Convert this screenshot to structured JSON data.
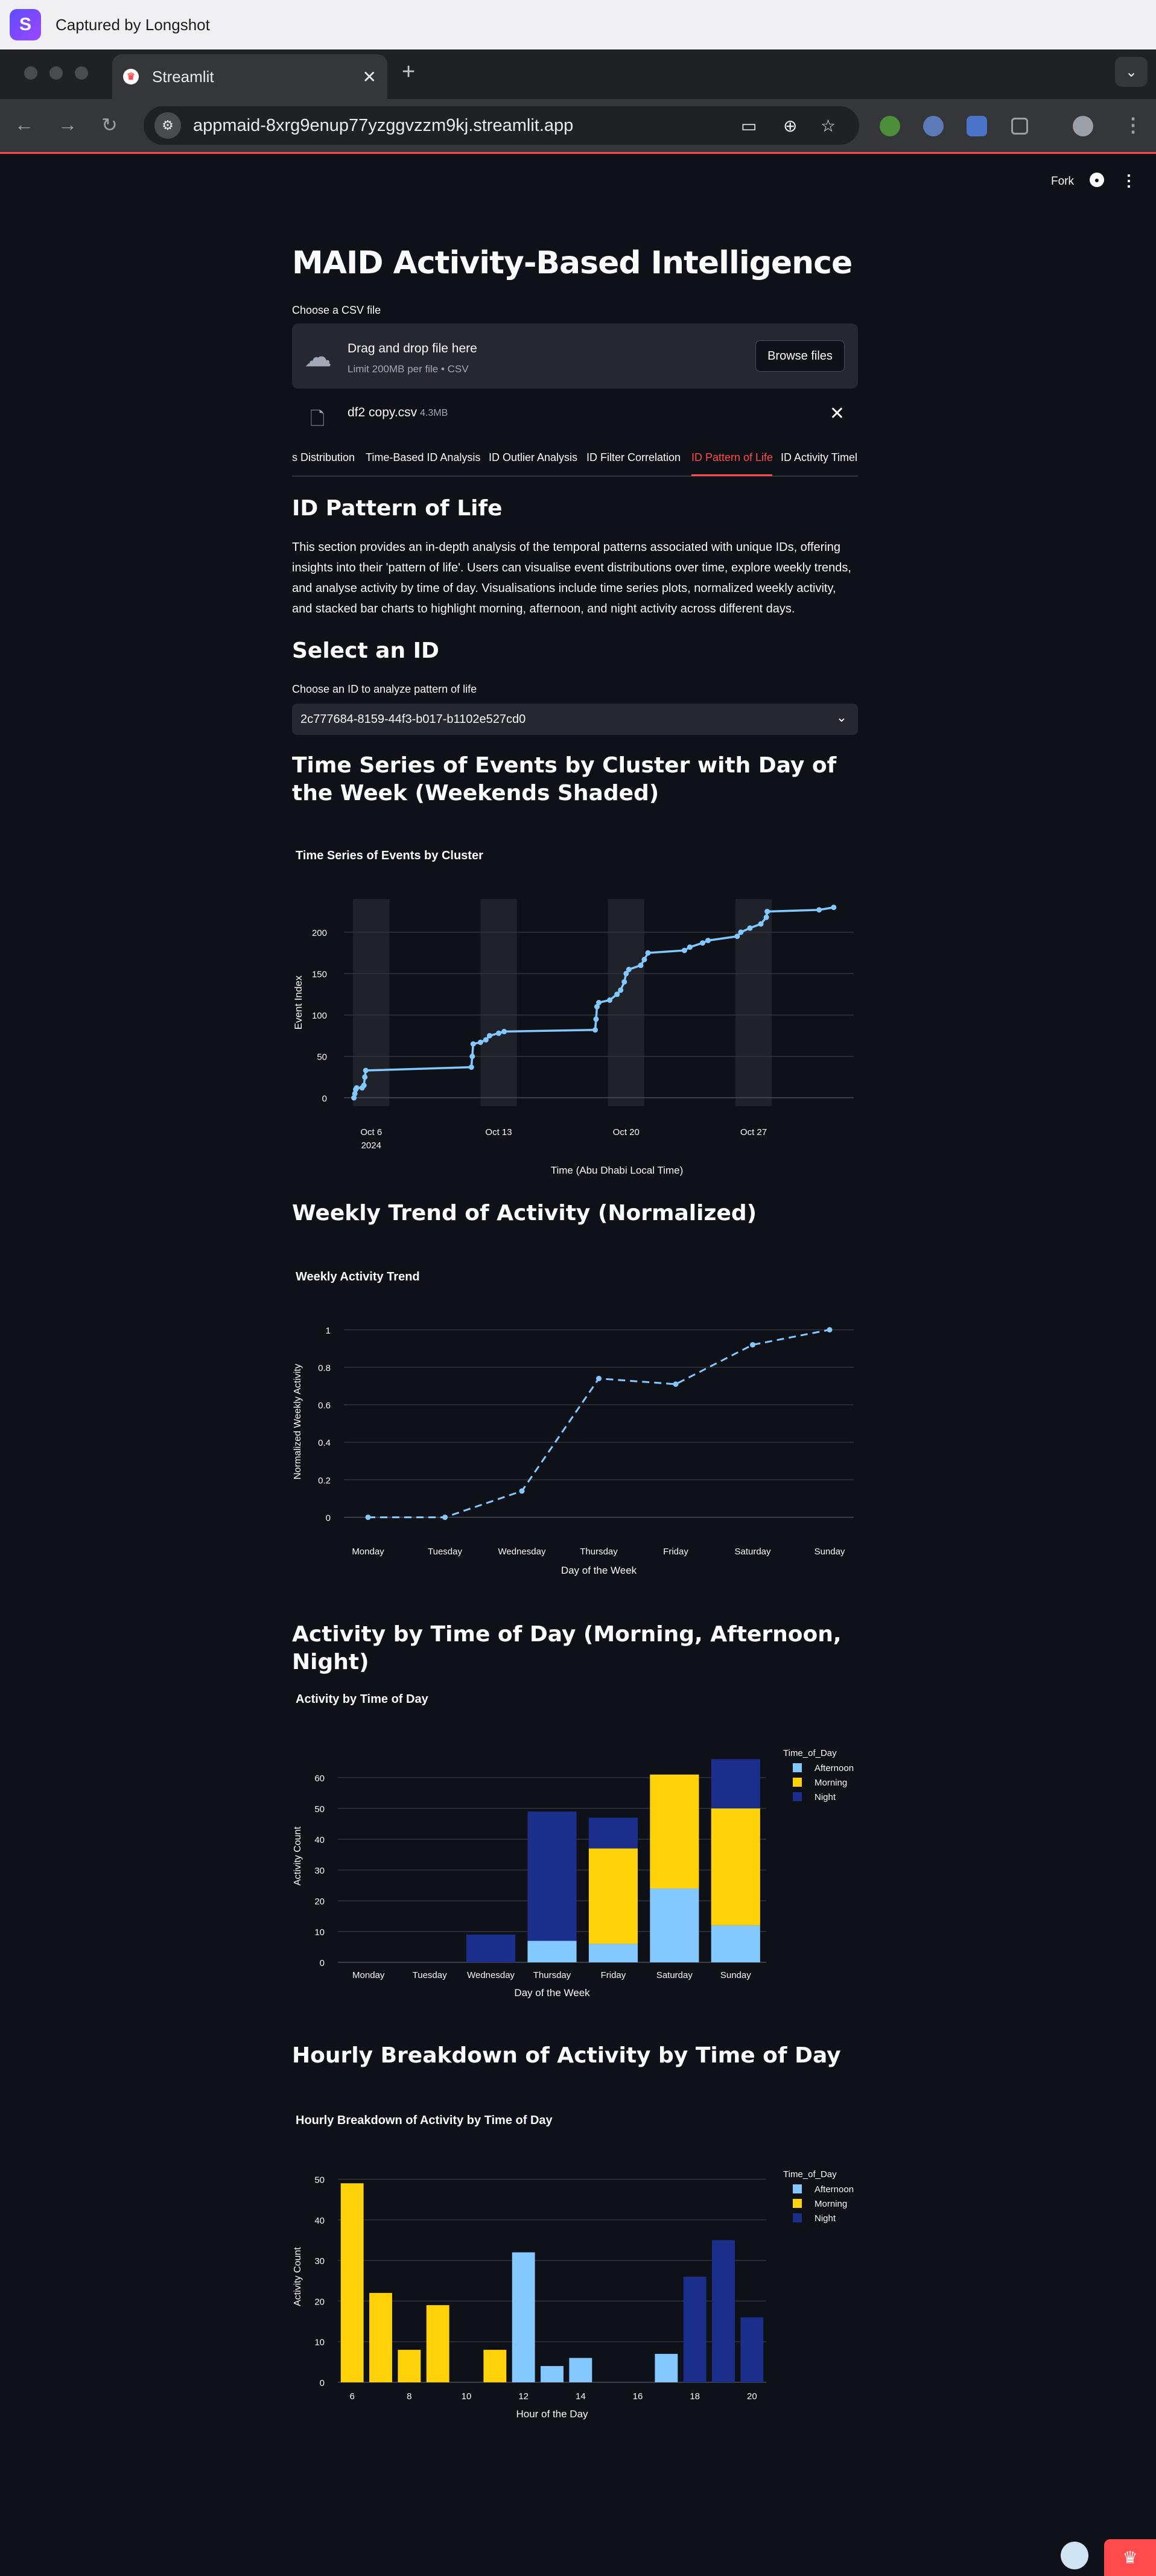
{
  "capture": {
    "title": "Captured by Longshot"
  },
  "browser": {
    "tab_title": "Streamlit",
    "url": "appmaid-8xrg9enup77yzggvzzm9kj.streamlit.app"
  },
  "header": {
    "fork_label": "Fork"
  },
  "main": {
    "title": "MAID Activity-Based Intelligence",
    "upload_label": "Choose a CSV file",
    "dropzone_text": "Drag and drop file here",
    "dropzone_limit": "Limit 200MB per file • CSV",
    "browse_label": "Browse files",
    "file_name": "df2 copy.csv",
    "file_size": "4.3MB",
    "tabs": [
      "s Distribution",
      "Time-Based ID Analysis",
      "ID Outlier Analysis",
      "ID Filter Correlation",
      "ID Pattern of Life",
      "ID Activity Timel"
    ],
    "section_title": "ID Pattern of Life",
    "section_body": "This section provides an in-depth analysis of the temporal patterns associated with unique IDs, offering insights into their 'pattern of life'. Users can visualise event distributions over time, explore weekly trends, and analyse activity by time of day. Visualisations include time series plots, normalized weekly activity, and stacked bar charts to highlight morning, afternoon, and night activity across different days.",
    "select_heading": "Select an ID",
    "select_label": "Choose an ID to analyze pattern of life",
    "select_value": "2c777684-8159-44f3-b017-b1102e527cd0",
    "h_timeseries": "Time Series of Events by Cluster with Day of the Week (Weekends Shaded)",
    "h_weekly": "Weekly Trend of Activity (Normalized)",
    "h_timeofday": "Activity by Time of Day (Morning, Afternoon, Night)",
    "h_hourly": "Hourly Breakdown of Activity by Time of Day"
  },
  "colors": {
    "afternoon": "#83c9ff",
    "morning": "#ffd20a",
    "night": "#1c2e8c",
    "line": "#83c9ff",
    "accent": "#ff4b4b"
  },
  "chart_data": [
    {
      "type": "line",
      "title": "Time Series of Events by Cluster",
      "xlabel": "Time (Abu Dhabi Local Time)",
      "ylabel": "Event Index",
      "x_ticks": [
        "Oct 6",
        "Oct 13",
        "Oct 20",
        "Oct 27"
      ],
      "x_tick_year": "2024",
      "y_ticks": [
        0,
        50,
        100,
        150,
        200
      ],
      "ylim": [
        -10,
        240
      ],
      "shaded_weekends": true,
      "x_unit": "days since Oct 5 2024",
      "points": [
        [
          0.05,
          0
        ],
        [
          0.1,
          5
        ],
        [
          0.15,
          10
        ],
        [
          0.2,
          12
        ],
        [
          0.5,
          12
        ],
        [
          0.6,
          15
        ],
        [
          0.65,
          25
        ],
        [
          0.7,
          33
        ],
        [
          6.5,
          37
        ],
        [
          6.55,
          50
        ],
        [
          6.6,
          65
        ],
        [
          7.0,
          67
        ],
        [
          7.3,
          70
        ],
        [
          7.5,
          75
        ],
        [
          8.0,
          78
        ],
        [
          8.3,
          80
        ],
        [
          13.3,
          82
        ],
        [
          13.35,
          95
        ],
        [
          13.4,
          110
        ],
        [
          13.5,
          115
        ],
        [
          14.1,
          118
        ],
        [
          14.5,
          125
        ],
        [
          14.7,
          130
        ],
        [
          14.9,
          140
        ],
        [
          15.0,
          150
        ],
        [
          15.15,
          155
        ],
        [
          15.8,
          160
        ],
        [
          16.0,
          167
        ],
        [
          16.2,
          175
        ],
        [
          18.2,
          178
        ],
        [
          18.5,
          182
        ],
        [
          19.2,
          187
        ],
        [
          19.5,
          190
        ],
        [
          21.1,
          195
        ],
        [
          21.3,
          200
        ],
        [
          21.8,
          205
        ],
        [
          22.4,
          210
        ],
        [
          22.7,
          218
        ],
        [
          22.75,
          225
        ],
        [
          25.6,
          227
        ],
        [
          26.4,
          230
        ]
      ]
    },
    {
      "type": "line",
      "title": "Weekly Activity Trend",
      "xlabel": "Day of the Week",
      "ylabel": "Normalized Weekly Activity",
      "categories": [
        "Monday",
        "Tuesday",
        "Wednesday",
        "Thursday",
        "Friday",
        "Saturday",
        "Sunday"
      ],
      "values": [
        0,
        0,
        0.14,
        0.74,
        0.71,
        0.92,
        1.0
      ],
      "y_ticks": [
        0,
        0.2,
        0.4,
        0.6,
        0.8,
        1
      ],
      "ylim": [
        -0.05,
        1.07
      ]
    },
    {
      "type": "bar",
      "stacked": true,
      "title": "Activity by Time of Day",
      "xlabel": "Day of the Week",
      "ylabel": "Activity Count",
      "legend_title": "Time_of_Day",
      "categories": [
        "Monday",
        "Tuesday",
        "Wednesday",
        "Thursday",
        "Friday",
        "Saturday",
        "Sunday"
      ],
      "series": [
        {
          "name": "Afternoon",
          "values": [
            0,
            0,
            0,
            7,
            6,
            24,
            12
          ]
        },
        {
          "name": "Morning",
          "values": [
            0,
            0,
            0,
            0,
            31,
            37,
            38
          ]
        },
        {
          "name": "Night",
          "values": [
            0,
            0,
            9,
            42,
            10,
            0,
            16
          ]
        }
      ],
      "y_ticks": [
        0,
        10,
        20,
        30,
        40,
        50,
        60
      ],
      "ylim": [
        0,
        69
      ]
    },
    {
      "type": "bar",
      "title": "Hourly Breakdown of Activity by Time of Day",
      "xlabel": "Hour of the Day",
      "ylabel": "Activity Count",
      "legend_title": "Time_of_Day",
      "x_ticks": [
        6,
        8,
        10,
        12,
        14,
        16,
        18,
        20
      ],
      "bars": [
        {
          "hour": 6,
          "value": 49,
          "cat": "Morning"
        },
        {
          "hour": 7,
          "value": 22,
          "cat": "Morning"
        },
        {
          "hour": 8,
          "value": 8,
          "cat": "Morning"
        },
        {
          "hour": 9,
          "value": 19,
          "cat": "Morning"
        },
        {
          "hour": 11,
          "value": 8,
          "cat": "Morning"
        },
        {
          "hour": 12,
          "value": 32,
          "cat": "Afternoon"
        },
        {
          "hour": 13,
          "value": 4,
          "cat": "Afternoon"
        },
        {
          "hour": 14,
          "value": 6,
          "cat": "Afternoon"
        },
        {
          "hour": 17,
          "value": 7,
          "cat": "Afternoon"
        },
        {
          "hour": 18,
          "value": 26,
          "cat": "Night"
        },
        {
          "hour": 19,
          "value": 35,
          "cat": "Night"
        },
        {
          "hour": 20,
          "value": 16,
          "cat": "Night"
        }
      ],
      "legend": [
        "Afternoon",
        "Morning",
        "Night"
      ],
      "y_ticks": [
        0,
        10,
        20,
        30,
        40,
        50
      ],
      "ylim": [
        0,
        52
      ]
    }
  ]
}
